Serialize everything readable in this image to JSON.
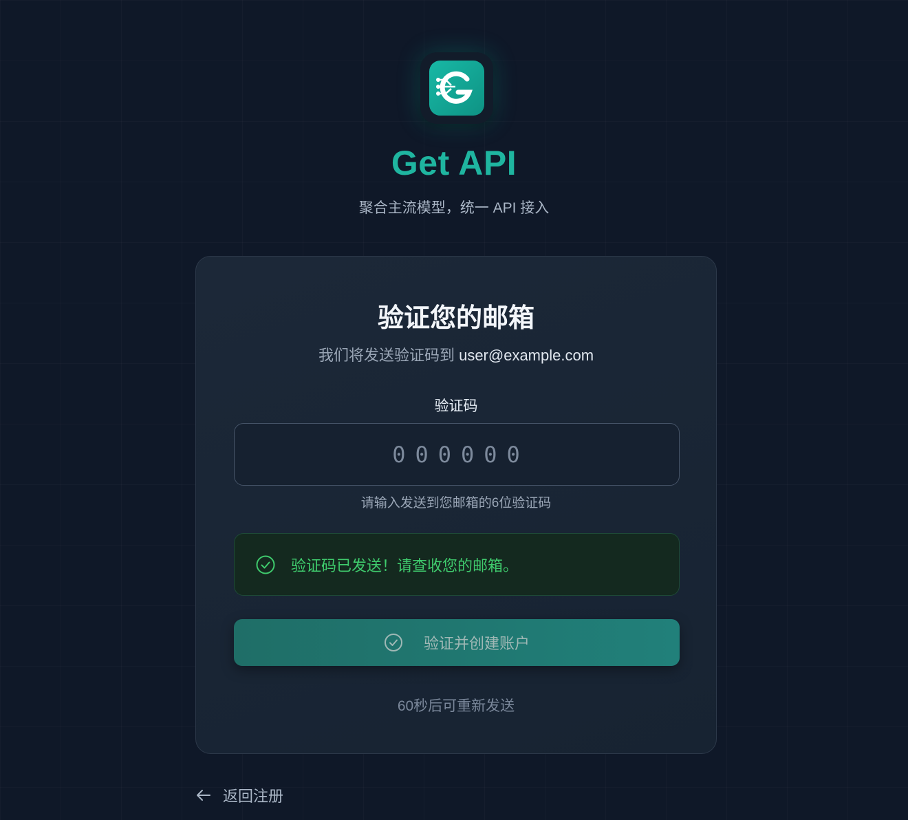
{
  "brand": {
    "logo_icon": "g-circuit-logo-icon",
    "name": "Get API",
    "tagline": "聚合主流模型，统一 API 接入",
    "accent_color": "#1fb5a0"
  },
  "card": {
    "title": "验证您的邮箱",
    "subtitle_prefix": "我们将发送验证码到",
    "email": "user@example.com",
    "code_label": "验证码",
    "code_placeholder": "000000",
    "code_value": "",
    "hint": "请输入发送到您邮箱的6位验证码",
    "alert": {
      "icon": "check-circle-icon",
      "text": "验证码已发送！请查收您的邮箱。",
      "color": "#3fcb6d"
    },
    "submit_button": {
      "icon": "check-circle-icon",
      "label": "验证并创建账户"
    },
    "resend_text": "60秒后可重新发送"
  },
  "back_link": {
    "icon": "arrow-left-icon",
    "label": "返回注册"
  }
}
